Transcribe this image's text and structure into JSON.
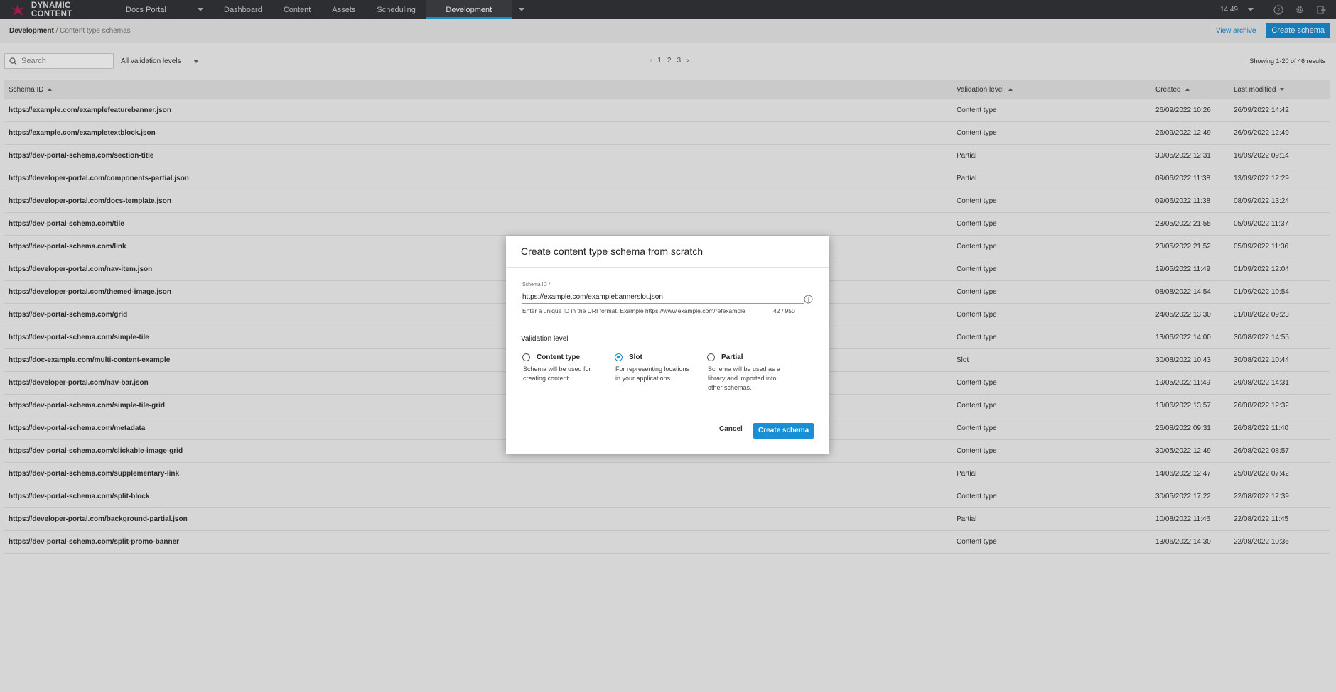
{
  "app": {
    "name": "DYNAMIC CONTENT",
    "hub": "Docs Portal",
    "time": "14:49"
  },
  "nav": [
    "Dashboard",
    "Content",
    "Assets",
    "Scheduling",
    "Development"
  ],
  "breadcrumb": {
    "root": "Development",
    "current": " / Content type schemas"
  },
  "actions": {
    "view_archive": "View archive",
    "create_schema": "Create schema"
  },
  "filters": {
    "search_placeholder": "Search",
    "validation_filter": "All validation levels"
  },
  "pagination": {
    "pages": [
      "1",
      "2",
      "3"
    ],
    "results": "Showing 1-20 of 46 results"
  },
  "table": {
    "headers": {
      "schema_id": "Schema ID",
      "validation": "Validation level",
      "created": "Created",
      "modified": "Last modified"
    },
    "rows": [
      {
        "id": "https://example.com/examplefeaturebanner.json",
        "level": "Content type",
        "created": "26/09/2022 10:26",
        "modified": "26/09/2022 14:42"
      },
      {
        "id": "https://example.com/exampletextblock.json",
        "level": "Content type",
        "created": "26/09/2022 12:49",
        "modified": "26/09/2022 12:49"
      },
      {
        "id": "https://dev-portal-schema.com/section-title",
        "level": "Partial",
        "created": "30/05/2022 12:31",
        "modified": "16/09/2022 09:14"
      },
      {
        "id": "https://developer-portal.com/components-partial.json",
        "level": "Partial",
        "created": "09/06/2022 11:38",
        "modified": "13/09/2022 12:29"
      },
      {
        "id": "https://developer-portal.com/docs-template.json",
        "level": "Content type",
        "created": "09/06/2022 11:38",
        "modified": "08/09/2022 13:24"
      },
      {
        "id": "https://dev-portal-schema.com/tile",
        "level": "Content type",
        "created": "23/05/2022 21:55",
        "modified": "05/09/2022 11:37"
      },
      {
        "id": "https://dev-portal-schema.com/link",
        "level": "Content type",
        "created": "23/05/2022 21:52",
        "modified": "05/09/2022 11:36"
      },
      {
        "id": "https://developer-portal.com/nav-item.json",
        "level": "Content type",
        "created": "19/05/2022 11:49",
        "modified": "01/09/2022 12:04"
      },
      {
        "id": "https://developer-portal.com/themed-image.json",
        "level": "Content type",
        "created": "08/08/2022 14:54",
        "modified": "01/09/2022 10:54"
      },
      {
        "id": "https://dev-portal-schema.com/grid",
        "level": "Content type",
        "created": "24/05/2022 13:30",
        "modified": "31/08/2022 09:23"
      },
      {
        "id": "https://dev-portal-schema.com/simple-tile",
        "level": "Content type",
        "created": "13/06/2022 14:00",
        "modified": "30/08/2022 14:55"
      },
      {
        "id": "https://doc-example.com/multi-content-example",
        "level": "Slot",
        "created": "30/08/2022 10:43",
        "modified": "30/08/2022 10:44"
      },
      {
        "id": "https://developer-portal.com/nav-bar.json",
        "level": "Content type",
        "created": "19/05/2022 11:49",
        "modified": "29/08/2022 14:31"
      },
      {
        "id": "https://dev-portal-schema.com/simple-tile-grid",
        "level": "Content type",
        "created": "13/06/2022 13:57",
        "modified": "26/08/2022 12:32"
      },
      {
        "id": "https://dev-portal-schema.com/metadata",
        "level": "Content type",
        "created": "26/08/2022 09:31",
        "modified": "26/08/2022 11:40"
      },
      {
        "id": "https://dev-portal-schema.com/clickable-image-grid",
        "level": "Content type",
        "created": "30/05/2022 12:49",
        "modified": "26/08/2022 08:57"
      },
      {
        "id": "https://dev-portal-schema.com/supplementary-link",
        "level": "Partial",
        "created": "14/06/2022 12:47",
        "modified": "25/08/2022 07:42"
      },
      {
        "id": "https://dev-portal-schema.com/split-block",
        "level": "Content type",
        "created": "30/05/2022 17:22",
        "modified": "22/08/2022 12:39"
      },
      {
        "id": "https://developer-portal.com/background-partial.json",
        "level": "Partial",
        "created": "10/08/2022 11:46",
        "modified": "22/08/2022 11:45"
      },
      {
        "id": "https://dev-portal-schema.com/split-promo-banner",
        "level": "Content type",
        "created": "13/06/2022 14:30",
        "modified": "22/08/2022 10:36"
      }
    ]
  },
  "modal": {
    "title": "Create content type schema from scratch",
    "field_label": "Schema ID *",
    "field_value": "https://example.com/examplebannerslot.json",
    "helper": "Enter a unique ID in the URI format. Example https://www.example.com/refexample",
    "counter": "42 / 950",
    "validation_title": "Validation level",
    "options": [
      {
        "label": "Content type",
        "desc": "Schema will be used for creating content.",
        "selected": false
      },
      {
        "label": "Slot",
        "desc": "For representing locations in your applications.",
        "selected": true
      },
      {
        "label": "Partial",
        "desc": "Schema will be used as a library and imported into other schemas.",
        "selected": false
      }
    ],
    "cancel": "Cancel",
    "submit": "Create schema"
  },
  "colors": {
    "accent": "#1a8fd6",
    "topbar": "#333538",
    "logo": "#c2185b"
  }
}
